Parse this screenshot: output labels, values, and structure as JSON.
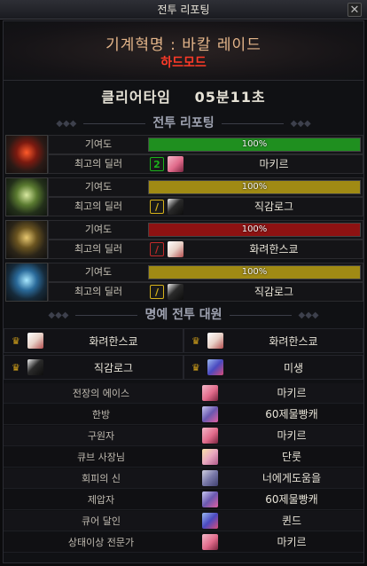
{
  "window": {
    "title": "전투 리포팅",
    "close_glyph": "✕"
  },
  "header": {
    "raid_title": "기계혁명 : 바칼 레이드",
    "mode": "하드모드"
  },
  "clear": {
    "label": "클리어타임",
    "time": "05분11초"
  },
  "sections": {
    "battle_report": "전투 리포팅",
    "honor": "명예 전투 대원"
  },
  "parties": [
    {
      "portrait": "red-helmet-icon",
      "contribution_label": "기여도",
      "contribution": "100%",
      "fill": 1.0,
      "bar_color": "#1f8f1f",
      "dealer_label": "최고의 딜러",
      "badge": "2",
      "badge_color": "#1bb21b",
      "dealer": "마키르",
      "avatar": "pink-hair-avatar"
    },
    {
      "portrait": "green-helmet-icon",
      "contribution_label": "기여도",
      "contribution": "100%",
      "fill": 1.0,
      "bar_color": "#a08a14",
      "dealer_label": "최고의 딜러",
      "badge": "/",
      "badge_color": "#d6b21a",
      "dealer": "직감로그",
      "avatar": "dark-ninja-avatar"
    },
    {
      "portrait": "gold-helmet-icon",
      "contribution_label": "기여도",
      "contribution": "100%",
      "fill": 1.0,
      "bar_color": "#8e1212",
      "dealer_label": "최고의 딜러",
      "badge": "/",
      "badge_color": "#c22a2a",
      "dealer": "화려한스쿄",
      "avatar": "white-hair-avatar"
    },
    {
      "portrait": "blue-helmet-icon",
      "contribution_label": "기여도",
      "contribution": "100%",
      "fill": 1.0,
      "bar_color": "#a08a14",
      "dealer_label": "최고의 딜러",
      "badge": "/",
      "badge_color": "#d6b21a",
      "dealer": "직감로그",
      "avatar": "dark-ninja-avatar"
    }
  ],
  "honor_members": [
    {
      "name": "화려한스쿄",
      "avatar": "white-hair-avatar"
    },
    {
      "name": "화려한스쿄",
      "avatar": "white-hair-avatar"
    },
    {
      "name": "직감로그",
      "avatar": "dark-ninja-avatar"
    },
    {
      "name": "미생",
      "avatar": "blue-mage-avatar"
    }
  ],
  "awards": [
    {
      "title": "전장의 에이스",
      "name": "마키르",
      "avatar": "pink-hair-avatar"
    },
    {
      "title": "한방",
      "name": "60제물빵캐",
      "avatar": "purple-hair-avatar"
    },
    {
      "title": "구원자",
      "name": "마키르",
      "avatar": "pink-hair-avatar"
    },
    {
      "title": "큐브 사장님",
      "name": "단룻",
      "avatar": "blonde-avatar"
    },
    {
      "title": "회피의 신",
      "name": "너에게도움을",
      "avatar": "grey-hair-avatar"
    },
    {
      "title": "제압자",
      "name": "60제물빵캐",
      "avatar": "purple-hair-avatar"
    },
    {
      "title": "큐어 달인",
      "name": "퀸드",
      "avatar": "blue-mage-avatar"
    },
    {
      "title": "상태이상 전문가",
      "name": "마키르",
      "avatar": "pink-hair-avatar"
    }
  ],
  "colors": {
    "accent_title": "#e4b58a",
    "hard_mode": "#ff3a28",
    "crown": "#d4a21a"
  }
}
